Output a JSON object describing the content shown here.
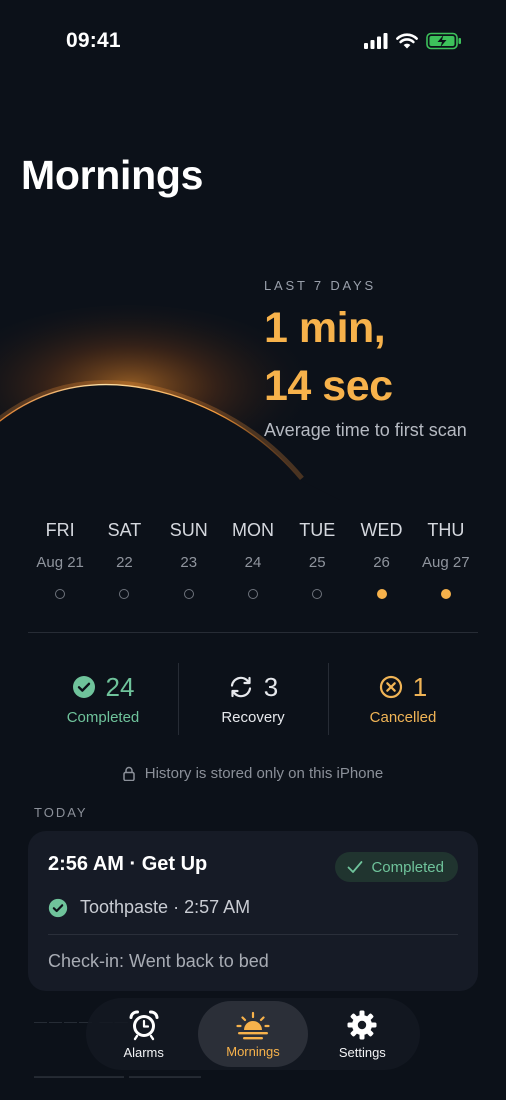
{
  "status_bar": {
    "time": "09:41"
  },
  "page": {
    "title": "Mornings"
  },
  "stats": {
    "label": "LAST 7 DAYS",
    "value_line1": "1 min,",
    "value_line2": "14 sec",
    "caption": "Average time to first scan"
  },
  "week": [
    {
      "name": "FRI",
      "date": "Aug 21",
      "active": false
    },
    {
      "name": "SAT",
      "date": "22",
      "active": false
    },
    {
      "name": "SUN",
      "date": "23",
      "active": false
    },
    {
      "name": "MON",
      "date": "24",
      "active": false
    },
    {
      "name": "TUE",
      "date": "25",
      "active": false
    },
    {
      "name": "WED",
      "date": "26",
      "active": true
    },
    {
      "name": "THU",
      "date": "Aug 27",
      "active": true
    }
  ],
  "counts": {
    "completed": {
      "value": "24",
      "label": "Completed"
    },
    "recovery": {
      "value": "3",
      "label": "Recovery"
    },
    "cancelled": {
      "value": "1",
      "label": "Cancelled"
    }
  },
  "privacy_note": "History is stored only on this iPhone",
  "today": {
    "section_label": "TODAY",
    "card": {
      "title": "2:56 AM · Get Up",
      "badge": "Completed",
      "task": "Toothpaste · 2:57 AM",
      "checkin": "Check-in: Went back to bed"
    }
  },
  "tabs": [
    {
      "label": "Alarms",
      "icon": "alarm-clock-icon",
      "active": false
    },
    {
      "label": "Mornings",
      "icon": "sunrise-icon",
      "active": true
    },
    {
      "label": "Settings",
      "icon": "gear-icon",
      "active": false
    }
  ],
  "colors": {
    "accent": "#f7b24b",
    "completed": "#6fc39b",
    "cancelled": "#f0b456",
    "background": "#0c1119",
    "card": "#161b26"
  }
}
